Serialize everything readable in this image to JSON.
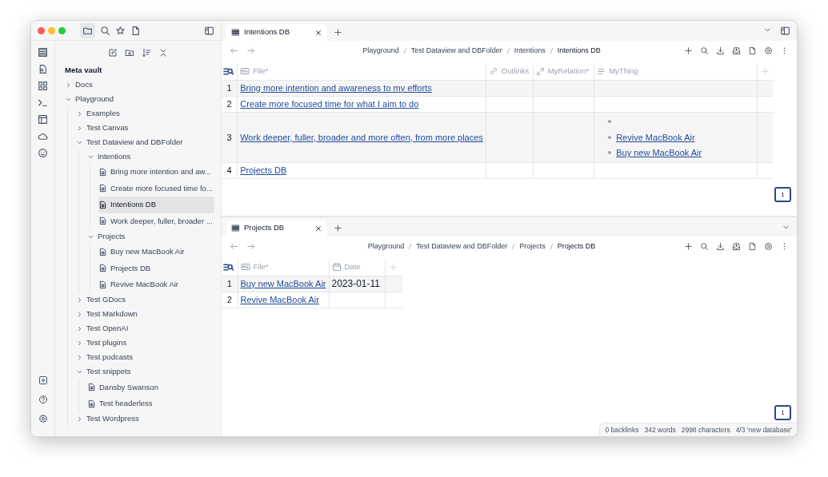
{
  "sidebar": {
    "vault_name": "Meta vault",
    "tree": [
      {
        "label": "Docs",
        "kind": "folder",
        "expanded": false,
        "selected": false
      },
      {
        "label": "Playground",
        "kind": "folder",
        "expanded": true,
        "selected": false,
        "children": [
          {
            "label": "Examples",
            "kind": "folder",
            "expanded": false,
            "selected": false
          },
          {
            "label": "Test Canvas",
            "kind": "folder",
            "expanded": false,
            "selected": false
          },
          {
            "label": "Test Dataview and DBFolder",
            "kind": "folder",
            "expanded": true,
            "selected": false,
            "children": [
              {
                "label": "Intentions",
                "kind": "folder",
                "expanded": true,
                "selected": false,
                "children": [
                  {
                    "label": "Bring more intention and aw...",
                    "kind": "file",
                    "selected": false
                  },
                  {
                    "label": "Create more focused time fo...",
                    "kind": "file",
                    "selected": false
                  },
                  {
                    "label": "Intentions DB",
                    "kind": "file",
                    "selected": true
                  },
                  {
                    "label": "Work deeper, fuller, broader ...",
                    "kind": "file",
                    "selected": false
                  }
                ]
              },
              {
                "label": "Projects",
                "kind": "folder",
                "expanded": true,
                "selected": false,
                "children": [
                  {
                    "label": "Buy new MacBook Air",
                    "kind": "file",
                    "selected": false
                  },
                  {
                    "label": "Projects DB",
                    "kind": "file",
                    "selected": false
                  },
                  {
                    "label": "Revive MacBook Air",
                    "kind": "file",
                    "selected": false
                  }
                ]
              }
            ]
          },
          {
            "label": "Test GDocs",
            "kind": "folder",
            "expanded": false,
            "selected": false
          },
          {
            "label": "Test Markdown",
            "kind": "folder",
            "expanded": false,
            "selected": false
          },
          {
            "label": "Test OpenAI",
            "kind": "folder",
            "expanded": false,
            "selected": false
          },
          {
            "label": "Test plugins",
            "kind": "folder",
            "expanded": false,
            "selected": false
          },
          {
            "label": "Test podcasts",
            "kind": "folder",
            "expanded": false,
            "selected": false
          },
          {
            "label": "Test snippets",
            "kind": "folder",
            "expanded": true,
            "selected": false,
            "children": [
              {
                "label": "Dansby Swanson",
                "kind": "file",
                "selected": false
              },
              {
                "label": "Test headerless",
                "kind": "file",
                "selected": false
              }
            ]
          },
          {
            "label": "Test Wordpress",
            "kind": "folder",
            "expanded": false,
            "selected": false
          }
        ]
      }
    ]
  },
  "panes": [
    {
      "tab": {
        "title": "Intentions DB"
      },
      "breadcrumb": [
        "Playground",
        "Test Dataview and DBFolder",
        "Intentions",
        "Intentions DB"
      ],
      "table": {
        "columns": [
          {
            "label": "File*",
            "kind": "file"
          },
          {
            "label": "Outlinks",
            "kind": "outlinks"
          },
          {
            "label": "MyRelation*",
            "kind": "relation"
          },
          {
            "label": "MyThing",
            "kind": "list"
          }
        ],
        "rows": [
          {
            "number": "1",
            "file": "Bring more intention and awareness to my efforts"
          },
          {
            "number": "2",
            "file": "Create more focused time for what I aim to do"
          },
          {
            "number": "3",
            "file": "Work deeper, fuller, broader and more often, from more places",
            "my_thing": [
              {
                "kind": "empty"
              },
              {
                "kind": "link",
                "text": "Revive MacBook Air"
              },
              {
                "kind": "link",
                "text": "Buy new MacBook Air"
              }
            ]
          },
          {
            "number": "4",
            "file": "Projects DB"
          }
        ]
      },
      "page_button": "1"
    },
    {
      "tab": {
        "title": "Projects DB"
      },
      "breadcrumb": [
        "Playground",
        "Test Dataview and DBFolder",
        "Projects",
        "Projects DB"
      ],
      "table": {
        "columns": [
          {
            "label": "File*",
            "kind": "file"
          },
          {
            "label": "Date",
            "kind": "date"
          }
        ],
        "rows": [
          {
            "number": "1",
            "file": "Buy new MacBook Air",
            "date": "2023-01-11"
          },
          {
            "number": "2",
            "file": "Revive MacBook Air"
          }
        ]
      },
      "page_button": "1"
    }
  ],
  "status_bar": [
    "0 backlinks",
    "342 words",
    "2998 characters",
    "4/3 'new database'"
  ]
}
